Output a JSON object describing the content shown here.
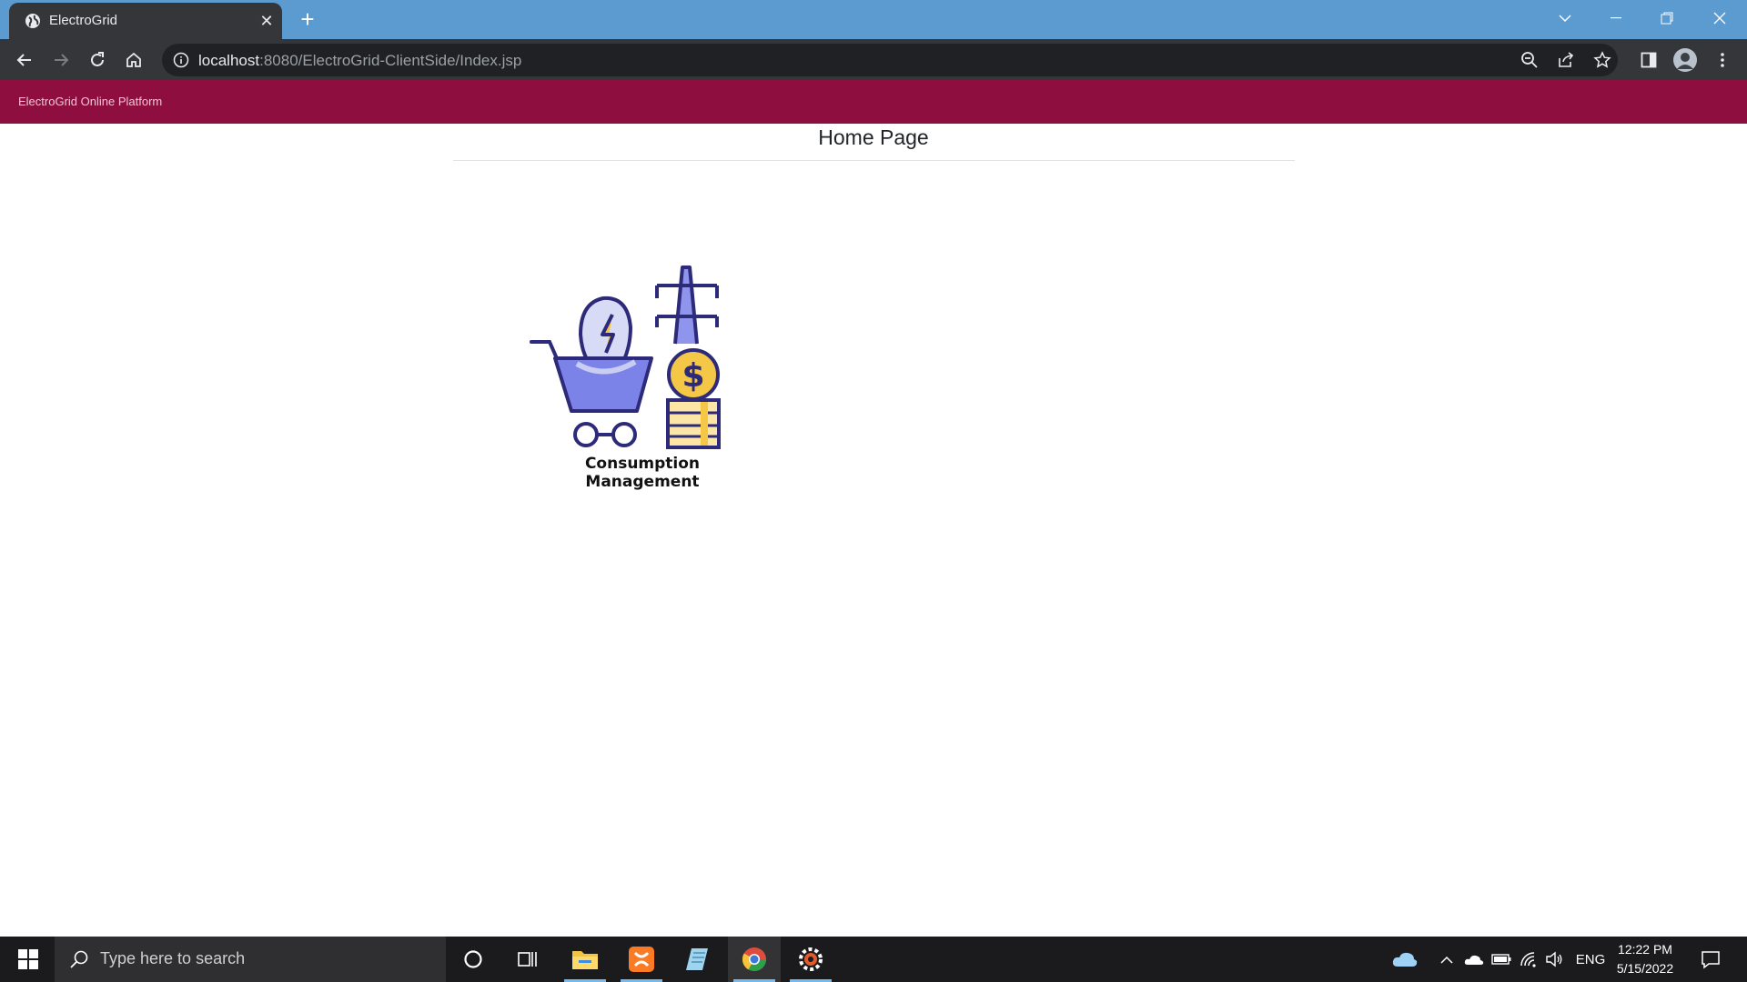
{
  "browser": {
    "tab_title": "ElectroGrid",
    "url_host": "localhost",
    "url_path": ":8080/ElectroGrid-ClientSide/Index.jsp"
  },
  "app": {
    "brand": "ElectroGrid Online Platform",
    "brand_color": "#8e0f3f",
    "page_title": "Home Page",
    "modules": [
      {
        "label": "Consumption Management",
        "icon": "consumption-management-icon"
      }
    ]
  },
  "taskbar": {
    "search_placeholder": "Type here to search",
    "language": "ENG",
    "time": "12:22 PM",
    "date": "5/15/2022"
  }
}
